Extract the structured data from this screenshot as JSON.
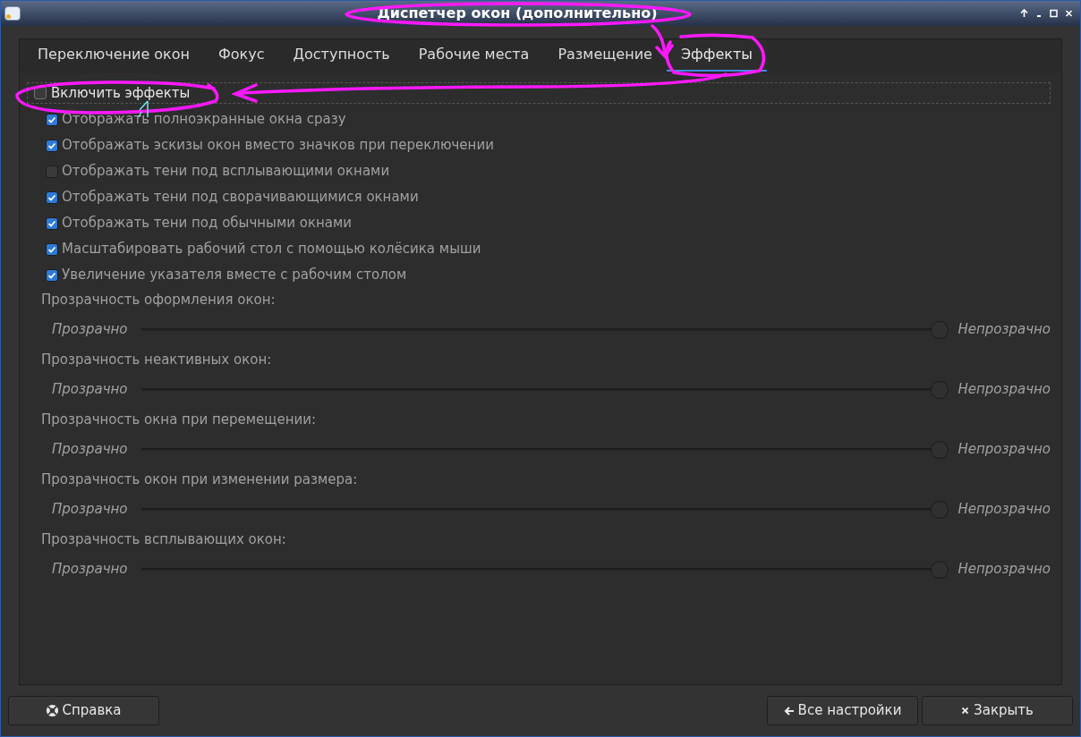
{
  "window": {
    "title": "Диспетчер окон (дополнительно)"
  },
  "tabs": [
    {
      "label": "Переключение окон",
      "selected": false
    },
    {
      "label": "Фокус",
      "selected": false
    },
    {
      "label": "Доступность",
      "selected": false
    },
    {
      "label": "Рабочие места",
      "selected": false
    },
    {
      "label": "Размещение",
      "selected": false
    },
    {
      "label": "Эффекты",
      "selected": true
    }
  ],
  "enable_effects": {
    "label": "Включить эффекты",
    "checked": false
  },
  "options": [
    {
      "label": "Отображать полноэкранные окна сразу",
      "checked": true,
      "disabled": true
    },
    {
      "label": "Отображать эскизы окон вместо значков при переключении",
      "checked": true,
      "disabled": true
    },
    {
      "label": "Отображать тени под всплывающими окнами",
      "checked": false,
      "disabled": true
    },
    {
      "label": "Отображать тени под сворачивающимися окнами",
      "checked": true,
      "disabled": true
    },
    {
      "label": "Отображать тени под обычными окнами",
      "checked": true,
      "disabled": true
    },
    {
      "label": "Масштабировать рабочий стол с помощью колёсика мыши",
      "checked": true,
      "disabled": true
    },
    {
      "label": "Увеличение указателя вместе с рабочим столом",
      "checked": true,
      "disabled": true
    }
  ],
  "sliders": [
    {
      "label": "Прозрачность оформления окон:",
      "min_label": "Прозрачно",
      "max_label": "Непрозрачно",
      "level": 1,
      "disabled": true
    },
    {
      "label": "Прозрачность неактивных окон:",
      "min_label": "Прозрачно",
      "max_label": "Непрозрачно",
      "level": 1,
      "disabled": true
    },
    {
      "label": "Прозрачность окна при перемещении:",
      "min_label": "Прозрачно",
      "max_label": "Непрозрачно",
      "level": 1,
      "disabled": true
    },
    {
      "label": "Прозрачность окон при изменении размера:",
      "min_label": "Прозрачно",
      "max_label": "Непрозрачно",
      "level": 1,
      "disabled": true
    },
    {
      "label": "Прозрачность всплывающих окон:",
      "min_label": "Прозрачно",
      "max_label": "Непрозрачно",
      "level": 1,
      "disabled": true
    }
  ],
  "buttons": {
    "help": "Справка",
    "all_settings": "Все настройки",
    "close": "Закрыть"
  }
}
